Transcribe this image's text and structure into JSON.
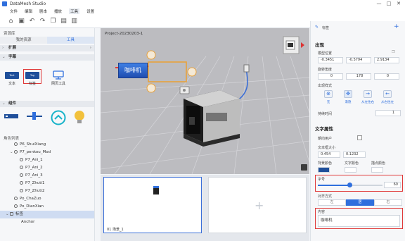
{
  "app": {
    "title": "DataMesh Studio",
    "accent": "#2f6fdd",
    "highlight": "#e03a3a"
  },
  "window_controls": [
    "—",
    "□",
    "✕"
  ],
  "menu": [
    "文件",
    "编辑",
    "剧本",
    "播放",
    "工具",
    "设置"
  ],
  "toolbar": [
    "home-icon",
    "save-icon",
    "undo-icon",
    "redo-icon",
    "copy-icon",
    "paste-icon",
    "delete-icon"
  ],
  "left": {
    "panel_title": "资源库",
    "tabs": [
      "我的资源",
      "工具"
    ],
    "sections": {
      "expand": "扩展",
      "text": "字幕",
      "component": "组件"
    },
    "text_assets": [
      {
        "label": "文本",
        "thumb": "Text"
      },
      {
        "label": "标签",
        "thumb": "Tag"
      },
      {
        "label": "网页工具",
        "thumb": ""
      }
    ],
    "tree_title": "角色列表",
    "tree": [
      "P6_ShuiXiang",
      "P7_penkou_Mod",
      "P7_Ani_1",
      "P7_Ani_2",
      "P7_Ani_3",
      "P7_Zhuti1",
      "P7_Zhuti2",
      "Po_ChaZuo",
      "Po_DianXian",
      "标签",
      "Anchor"
    ]
  },
  "viewport": {
    "project": "Project-20230203-1",
    "label_text": "咖啡机"
  },
  "bottom": {
    "scene_label": "01  场景_1"
  },
  "right": {
    "header": "标签",
    "appear_title": "出现",
    "model_pos_label": "模型位置",
    "model_pos": [
      "-0.3451",
      "-0.5794",
      "2.9134"
    ],
    "rot_label": "旋转角度",
    "rot": [
      "0",
      "178",
      "0"
    ],
    "style_label": "出现样式",
    "styles": [
      "无",
      "渐隐",
      "从左往右",
      "从右往左"
    ],
    "duration_label": "持续时间",
    "duration": "1",
    "text_attr_title": "文字属性",
    "face_user": "朝向用户",
    "size_label": "文本框大小",
    "size": [
      "0.454",
      "0.1232"
    ],
    "bg_color": "背景颜色",
    "text_color": "文字颜色",
    "anchor_color": "描点颜色",
    "font_size_label": "字号",
    "font_size": "60",
    "align_label": "对齐方式",
    "aligns": [
      "左",
      "居",
      "右"
    ],
    "content_label": "内容",
    "content": "咖啡机"
  }
}
